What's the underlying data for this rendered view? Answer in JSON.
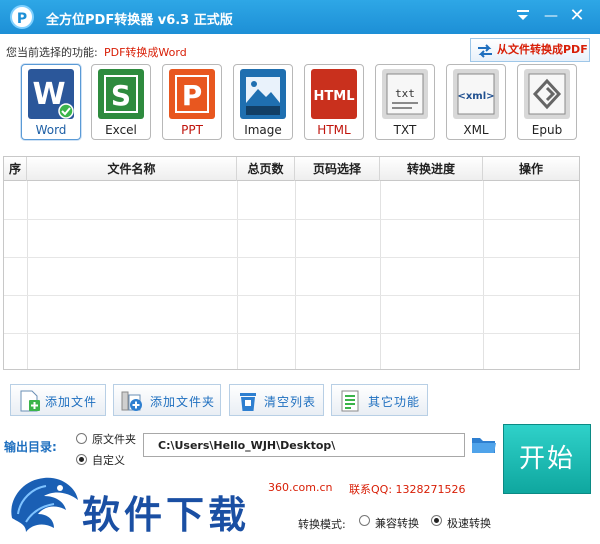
{
  "titlebar": {
    "logo_glyph": "P",
    "title": "全方位PDF转换器 v6.3 正式版",
    "min_glyph": "—",
    "close_glyph": "✕"
  },
  "function": {
    "label": "您当前选择的功能:",
    "value": "PDF转换成Word",
    "to_pdf_label": "从文件转换成PDF"
  },
  "formats": [
    {
      "label": "Word",
      "tile_text": "W",
      "color": "#2b579a",
      "icon": "word-icon",
      "active": true
    },
    {
      "label": "Excel",
      "tile_text": "S",
      "color": "#2e8b3e",
      "icon": "excel-icon"
    },
    {
      "label": "PPT",
      "tile_text": "P",
      "color": "#e8571f",
      "icon": "ppt-icon"
    },
    {
      "label": "Image",
      "tile_text": "images",
      "color": "#1f6fb0",
      "icon": "image-icon"
    },
    {
      "label": "HTML",
      "tile_text": "HTML",
      "color": "#c9301d",
      "icon": "html-icon"
    },
    {
      "label": "TXT",
      "tile_text": "txt",
      "color": "#9a9a9a",
      "icon": "txt-icon"
    },
    {
      "label": "XML",
      "tile_text": "<xml>",
      "color": "#9a9a9a",
      "icon": "xml-icon"
    },
    {
      "label": "Epub",
      "tile_text": "",
      "color": "#9a9a9a",
      "icon": "epub-icon"
    }
  ],
  "table": {
    "columns": [
      "序",
      "文件名称",
      "总页数",
      "页码选择",
      "转换进度",
      "操作"
    ]
  },
  "actions": {
    "add_file": "添加文件",
    "add_folder": "添加文件夹",
    "clear_list": "清空列表",
    "other": "其它功能"
  },
  "output": {
    "label": "输出目录:",
    "option_source": "原文件夹",
    "option_custom": "自定义",
    "path": "C:\\Users\\Hello_WJH\\Desktop\\"
  },
  "start_label": "开始",
  "footer": {
    "site": "360.com.cn",
    "qq": "联系QQ: 1328271526"
  },
  "watermark": {
    "text": "软件下载"
  },
  "mode": {
    "label": "转换模式:",
    "compat": "兼容转换",
    "fast": "极速转换"
  },
  "colors": {
    "titlebar": "#1d8fd6",
    "accent_red": "#d81e06",
    "link_blue": "#1e6fbf",
    "start": "#16b8b0"
  }
}
